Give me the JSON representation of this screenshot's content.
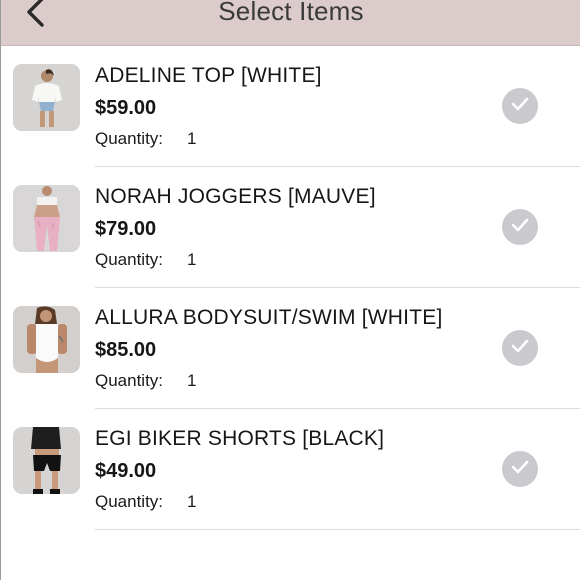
{
  "header": {
    "title": "Select Items",
    "back_icon": "chevron-left-icon"
  },
  "items": [
    {
      "name": "ADELINE TOP [WHITE]",
      "price": "$59.00",
      "quantity_label": "Quantity:",
      "quantity": "1",
      "selected": true
    },
    {
      "name": "NORAH JOGGERS [MAUVE]",
      "price": "$79.00",
      "quantity_label": "Quantity:",
      "quantity": "1",
      "selected": true
    },
    {
      "name": "ALLURA BODYSUIT/SWIM [WHITE]",
      "price": "$85.00",
      "quantity_label": "Quantity:",
      "quantity": "1",
      "selected": true
    },
    {
      "name": "EGI BIKER SHORTS [BLACK]",
      "price": "$49.00",
      "quantity_label": "Quantity:",
      "quantity": "1",
      "selected": true
    }
  ],
  "colors": {
    "header_bg": "#dccbcb",
    "check_bg": "#c9c9ce",
    "divider": "#dcdcdc"
  }
}
